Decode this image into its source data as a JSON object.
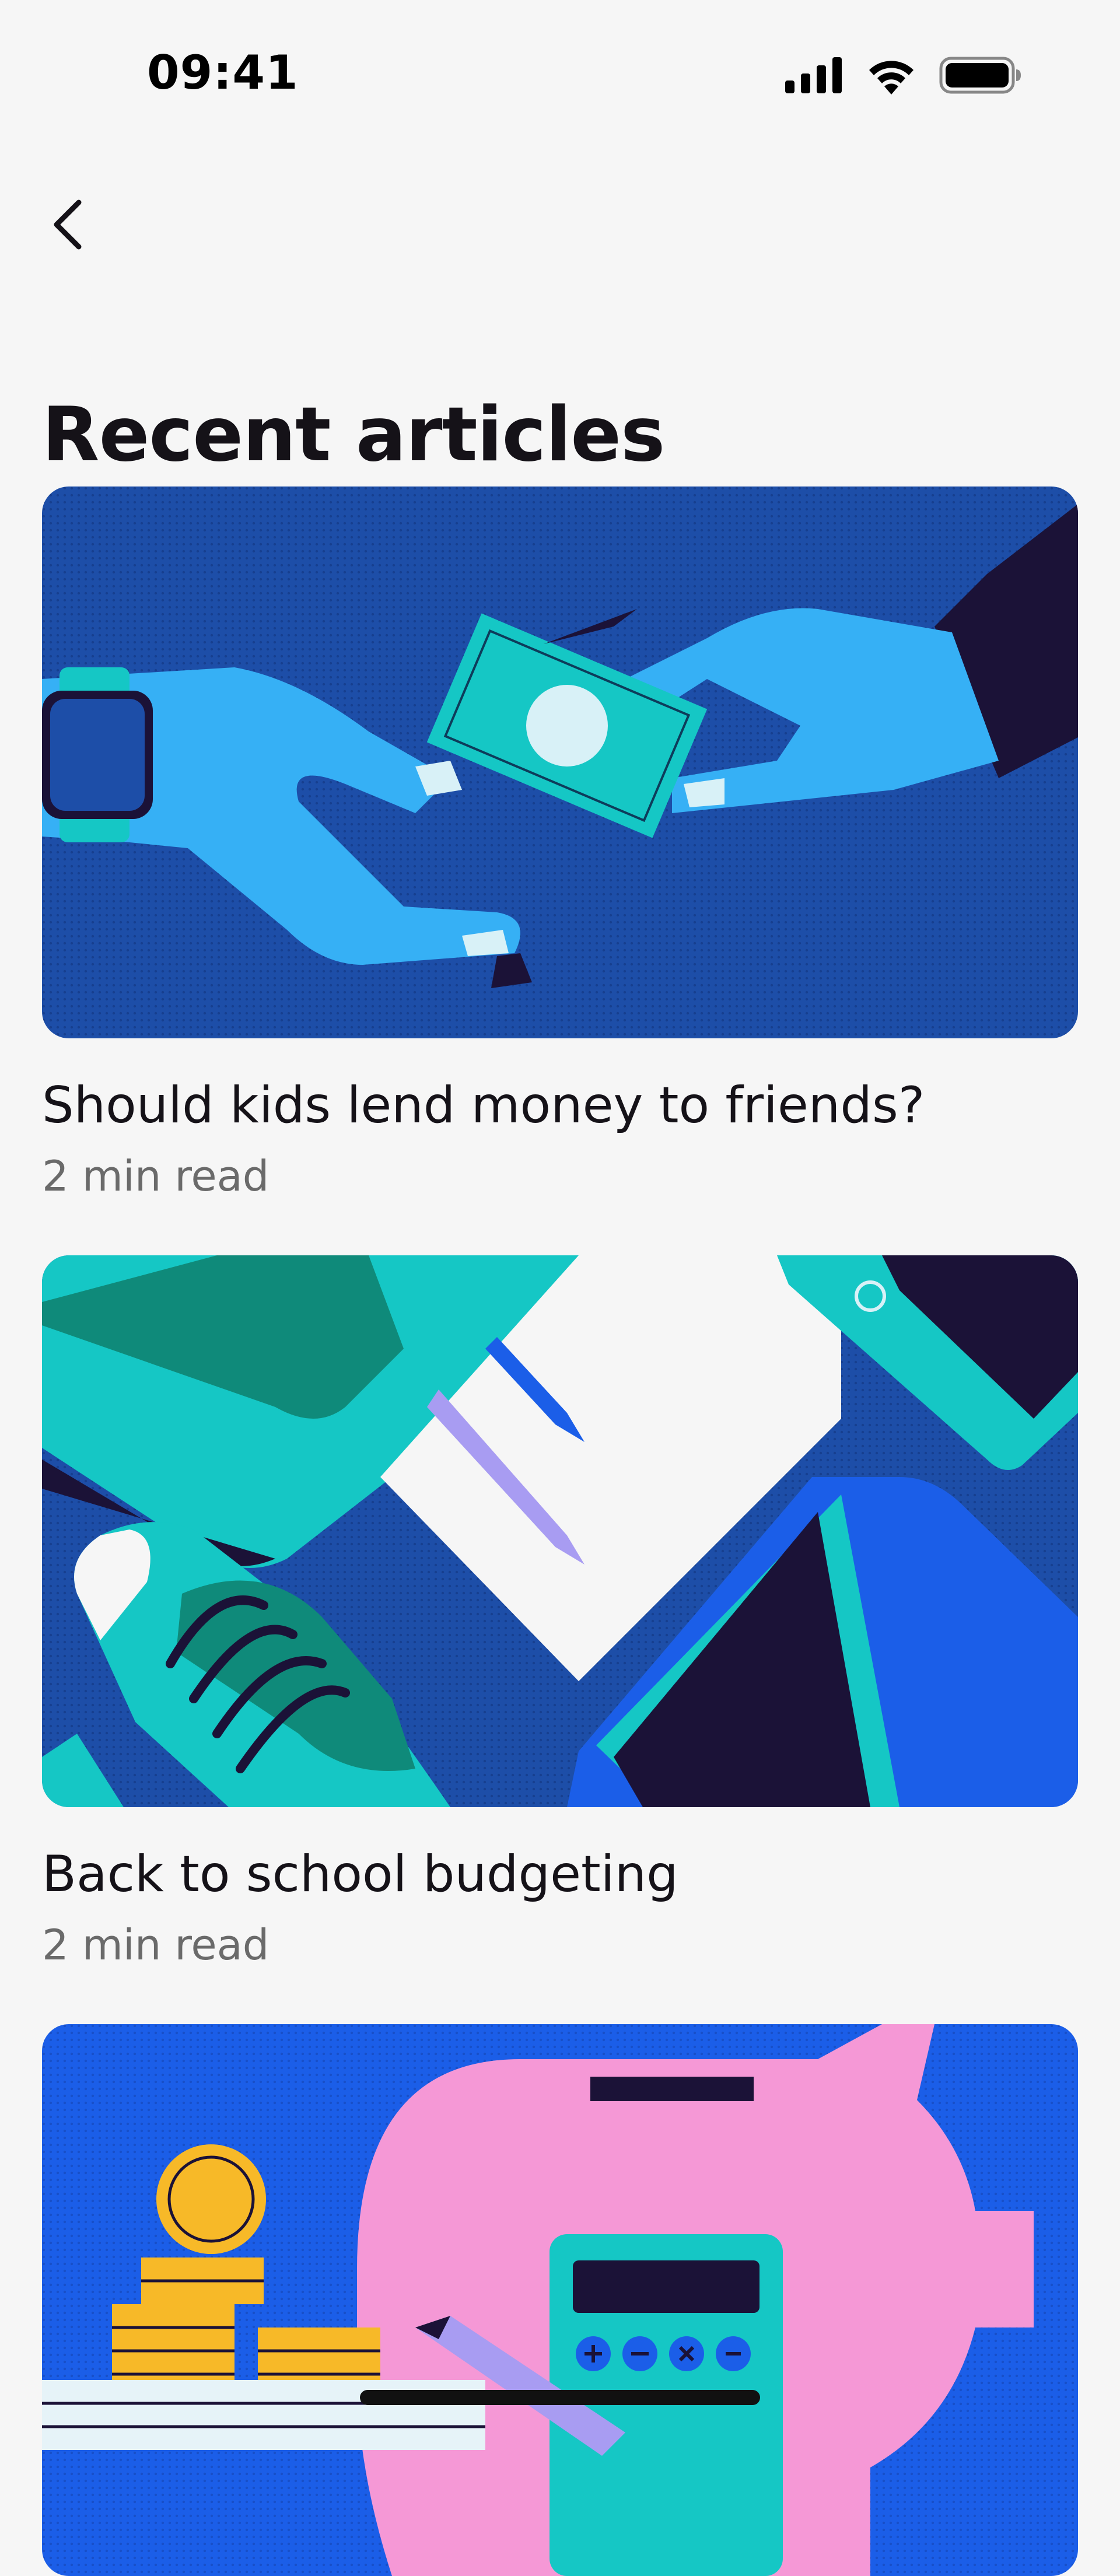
{
  "status_bar": {
    "time": "09:41",
    "icons": [
      "cellular-signal-icon",
      "wifi-icon",
      "battery-icon"
    ]
  },
  "navigation": {
    "back_icon": "chevron-left-icon"
  },
  "page": {
    "title": "Recent articles"
  },
  "articles": [
    {
      "title": "Should kids lend money to friends?",
      "read_time": "2 min read",
      "image": "hands-exchanging-banknote-illustration"
    },
    {
      "title": "Back to school budgeting",
      "read_time": "2 min read",
      "image": "school-supplies-illustration"
    },
    {
      "title": "",
      "read_time": "",
      "image": "piggy-bank-coins-calculator-illustration"
    }
  ],
  "colors": {
    "background": "#f6f6f6",
    "text_primary": "#151218",
    "text_secondary": "#6a6a6a",
    "illustration_navy": "#1d4ea8",
    "illustration_sky": "#36b0f5",
    "illustration_teal": "#15c7c5",
    "illustration_dark": "#1b1237",
    "illustration_blue": "#1b5ee8",
    "illustration_pink": "#f598d6",
    "illustration_gold": "#f7b928"
  }
}
